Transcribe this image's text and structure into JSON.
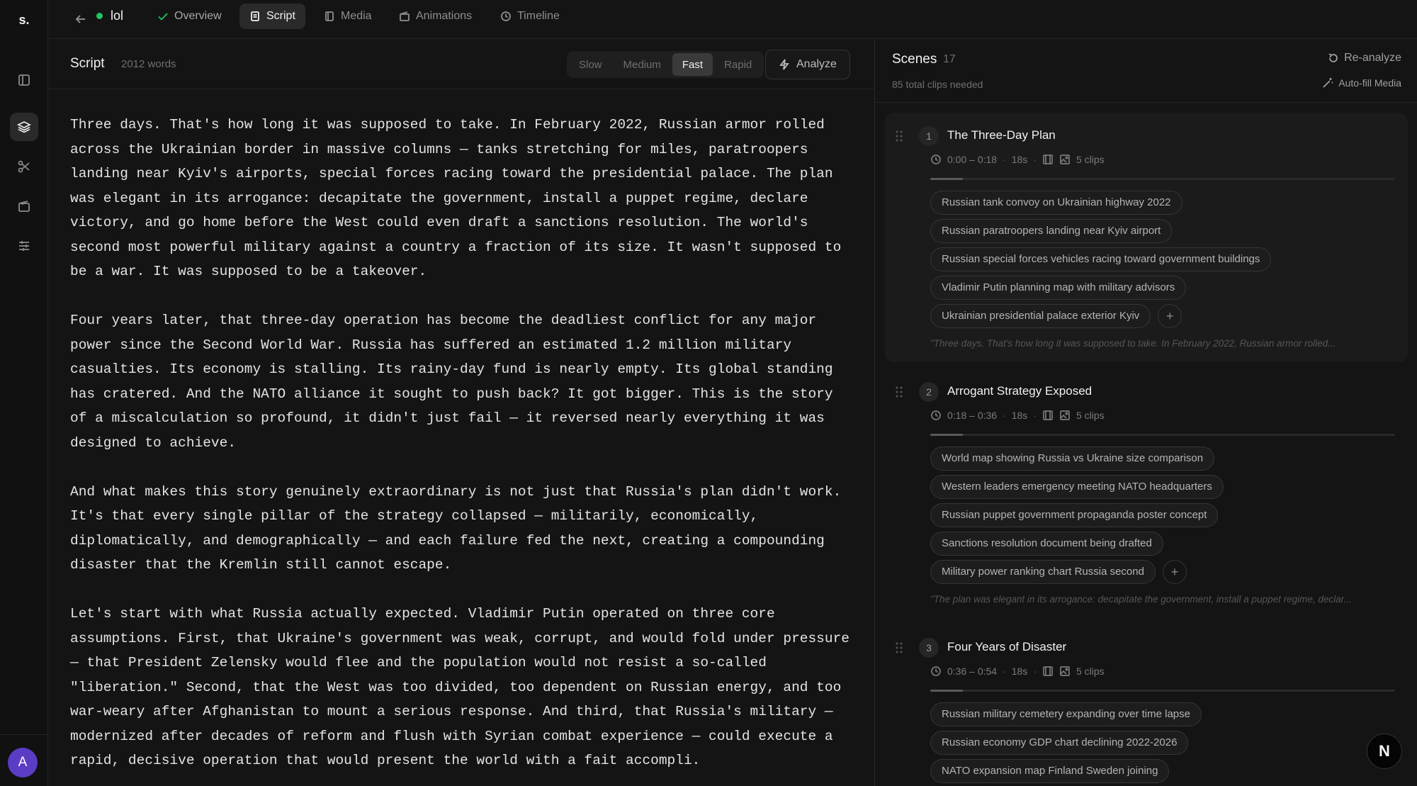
{
  "app": {
    "logo": "s.",
    "avatar_initial": "A",
    "avatar_color": "#5b3cc4"
  },
  "topbar": {
    "project_name": "lol",
    "status_color": "#22c55e",
    "tabs": [
      {
        "label": "Overview",
        "icon": "check-icon",
        "state": "done"
      },
      {
        "label": "Script",
        "icon": "script-icon",
        "state": "active"
      },
      {
        "label": "Media",
        "icon": "media-icon",
        "state": ""
      },
      {
        "label": "Animations",
        "icon": "animations-icon",
        "state": ""
      },
      {
        "label": "Timeline",
        "icon": "clock-icon",
        "state": ""
      }
    ]
  },
  "sidebar": {
    "items": [
      {
        "icon": "panel-icon",
        "active": false
      },
      {
        "icon": "layers-icon",
        "active": true
      },
      {
        "icon": "scissors-icon",
        "active": false
      },
      {
        "icon": "film-icon",
        "active": false
      },
      {
        "icon": "sliders-icon",
        "active": false
      }
    ]
  },
  "script": {
    "title": "Script",
    "word_count": "2012 words",
    "speeds": [
      "Slow",
      "Medium",
      "Fast",
      "Rapid"
    ],
    "selected_speed": "Fast",
    "analyze_label": "Analyze",
    "paragraphs": [
      "Three days. That's how long it was supposed to take. In February 2022, Russian armor rolled across the Ukrainian border in massive columns — tanks stretching for miles, paratroopers landing near Kyiv's airports, special forces racing toward the presidential palace. The plan was elegant in its arrogance: decapitate the government, install a puppet regime, declare victory, and go home before the West could even draft a sanctions resolution. The world's second most powerful military against a country a fraction of its size. It wasn't supposed to be a war. It was supposed to be a takeover.",
      "Four years later, that three-day operation has become the deadliest conflict for any major power since the Second World War. Russia has suffered an estimated 1.2 million military casualties. Its economy is stalling. Its rainy-day fund is nearly empty. Its global standing has cratered. And the NATO alliance it sought to push back? It got bigger. This is the story of a miscalculation so profound, it didn't just fail — it reversed nearly everything it was designed to achieve.",
      "And what makes this story genuinely extraordinary is not just that Russia's plan didn't work. It's that every single pillar of the strategy collapsed — militarily, economically, diplomatically, and demographically — and each failure fed the next, creating a compounding disaster that the Kremlin still cannot escape.",
      "Let's start with what Russia actually expected. Vladimir Putin operated on three core assumptions. First, that Ukraine's government was weak, corrupt, and would fold under pressure — that President Zelensky would flee and the population would not resist a so-called \"liberation.\" Second, that the West was too divided, too dependent on Russian energy, and too war-weary after Afghanistan to mount a serious response. And third, that Russia's military — modernized after decades of reform and flush with Syrian combat experience — could execute a rapid, decisive operation that would present the world with a fait accompli."
    ]
  },
  "scenes": {
    "title": "Scenes",
    "count": "17",
    "subtitle": "85 total clips needed",
    "reanalyze_label": "Re-analyze",
    "autofill_label": "Auto-fill Media",
    "items": [
      {
        "number": "1",
        "title": "The Three-Day Plan",
        "time": "0:00 – 0:18",
        "duration": "18s",
        "clips": "5 clips",
        "progress": 0.07,
        "chips": [
          "Russian tank convoy on Ukrainian highway 2022",
          "Russian paratroopers landing near Kyiv airport",
          "Russian special forces vehicles racing toward government buildings",
          "Vladimir Putin planning map with military advisors",
          "Ukrainian presidential palace exterior Kyiv"
        ],
        "add_label": "+",
        "excerpt": "\"Three days. That's how long it was supposed to take. In February 2022, Russian armor rolled..."
      },
      {
        "number": "2",
        "title": "Arrogant Strategy Exposed",
        "time": "0:18 – 0:36",
        "duration": "18s",
        "clips": "5 clips",
        "progress": 0.07,
        "chips": [
          "World map showing Russia vs Ukraine size comparison",
          "Western leaders emergency meeting NATO headquarters",
          "Russian puppet government propaganda poster concept",
          "Sanctions resolution document being drafted",
          "Military power ranking chart Russia second"
        ],
        "add_label": "+",
        "excerpt": "\"The plan was elegant in its arrogance: decapitate the government, install a puppet regime, declar..."
      },
      {
        "number": "3",
        "title": "Four Years of Disaster",
        "time": "0:36 – 0:54",
        "duration": "18s",
        "clips": "5 clips",
        "progress": 0.07,
        "chips": [
          "Russian military cemetery expanding over time lapse",
          "Russian economy GDP chart declining 2022-2026",
          "NATO expansion map Finland Sweden joining"
        ]
      }
    ]
  },
  "fab": {
    "label": "N"
  }
}
